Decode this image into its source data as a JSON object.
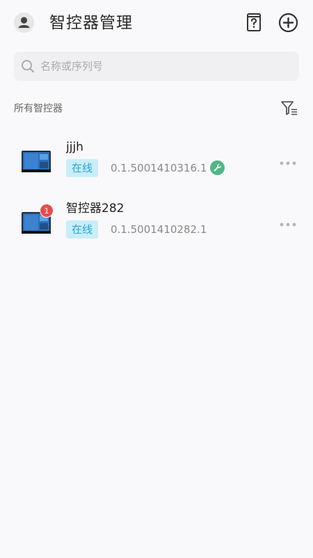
{
  "header": {
    "title": "智控器管理",
    "icons": [
      "user-avatar-icon",
      "help-book-icon",
      "add-circle-icon"
    ]
  },
  "search": {
    "placeholder": "名称或序列号",
    "value": ""
  },
  "list": {
    "section_label": "所有智控器",
    "filter_icon": "filter-icon",
    "devices": [
      {
        "name": "jjjh",
        "status": "在线",
        "serial": "0.1.5001410316.1",
        "has_wrench": true,
        "badge": ""
      },
      {
        "name": "智控器282",
        "status": "在线",
        "serial": "0.1.5001410282.1",
        "has_wrench": false,
        "badge": "1"
      }
    ]
  },
  "colors": {
    "status_bg": "#c9eef9",
    "status_text": "#2aa6d6",
    "badge": "#e84b4b",
    "wrench": "#4fb785"
  }
}
